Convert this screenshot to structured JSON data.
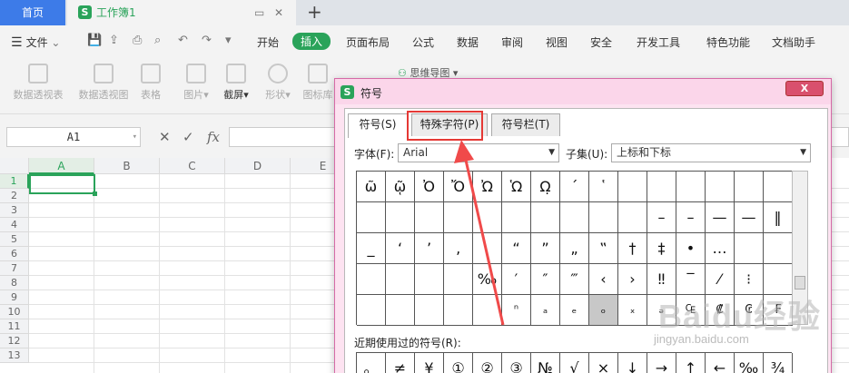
{
  "titlebar": {
    "home_tab": "首页",
    "doc_tab": "工作簿1",
    "new_tab": "+",
    "doc_logo": "S"
  },
  "menu": {
    "file": "文件",
    "items": [
      "开始",
      "插入",
      "页面布局",
      "公式",
      "数据",
      "审阅",
      "视图",
      "安全",
      "开发工具",
      "特色功能",
      "文档助手"
    ],
    "active": "插入"
  },
  "ribbon": {
    "items": [
      "数据透视表",
      "数据透视图",
      "表格",
      "图片",
      "截屏",
      "形状",
      "图标库"
    ],
    "mindmap": "思维导图"
  },
  "formula_bar": {
    "name_box": "A1",
    "fx": "fx"
  },
  "grid": {
    "columns": [
      "A",
      "B",
      "C",
      "D",
      "E"
    ],
    "rows": [
      "1",
      "2",
      "3",
      "4",
      "5",
      "6",
      "7",
      "8",
      "9",
      "10",
      "11",
      "12",
      "13"
    ],
    "active_cell": "A1"
  },
  "dialog": {
    "title": "符号",
    "close": "X",
    "tabs": [
      "符号(S)",
      "特殊字符(P)",
      "符号栏(T)"
    ],
    "active_tab": "符号(S)",
    "font_label": "字体(F):",
    "font_value": "Arial",
    "subset_label": "子集(U):",
    "subset_value": "上标和下标",
    "symbols": [
      [
        "ῶ",
        "ῷ",
        "Ὀ",
        "Ὄ",
        "Ὠ",
        "Ὡ",
        "Ω̣",
        "´",
        "῾",
        "",
        "",
        "",
        "",
        "",
        ""
      ],
      [
        "",
        "",
        "",
        "",
        "",
        "",
        "",
        "",
        "",
        "",
        "",
        "–",
        "–",
        "—",
        "—",
        "‖"
      ],
      [
        "_",
        "‘",
        "’",
        "‚",
        "",
        "“",
        "”",
        "„",
        "‟",
        "†",
        "‡",
        "•",
        "…",
        "",
        ""
      ],
      [
        "",
        "",
        "",
        "",
        "‰",
        "′",
        "″",
        "‴",
        "‹",
        "›",
        "‼",
        "‾",
        "⁄",
        "⁝",
        ""
      ],
      [
        "",
        "",
        "",
        "",
        "",
        "ⁿ",
        "ₐ",
        "ₑ",
        "ₒ",
        "ₓ",
        "ₔ",
        "₠",
        "₡",
        "₢",
        "₣"
      ]
    ],
    "recent_label": "近期使用过的符号(R):",
    "recent": [
      "。",
      "≠",
      "¥",
      "①",
      "②",
      "③",
      "№",
      "√",
      "×",
      "↓",
      "→",
      "↑",
      "←",
      "‰",
      "¾"
    ]
  },
  "watermark": {
    "brand": "Baidu经验",
    "url": "jingyan.baidu.com"
  }
}
